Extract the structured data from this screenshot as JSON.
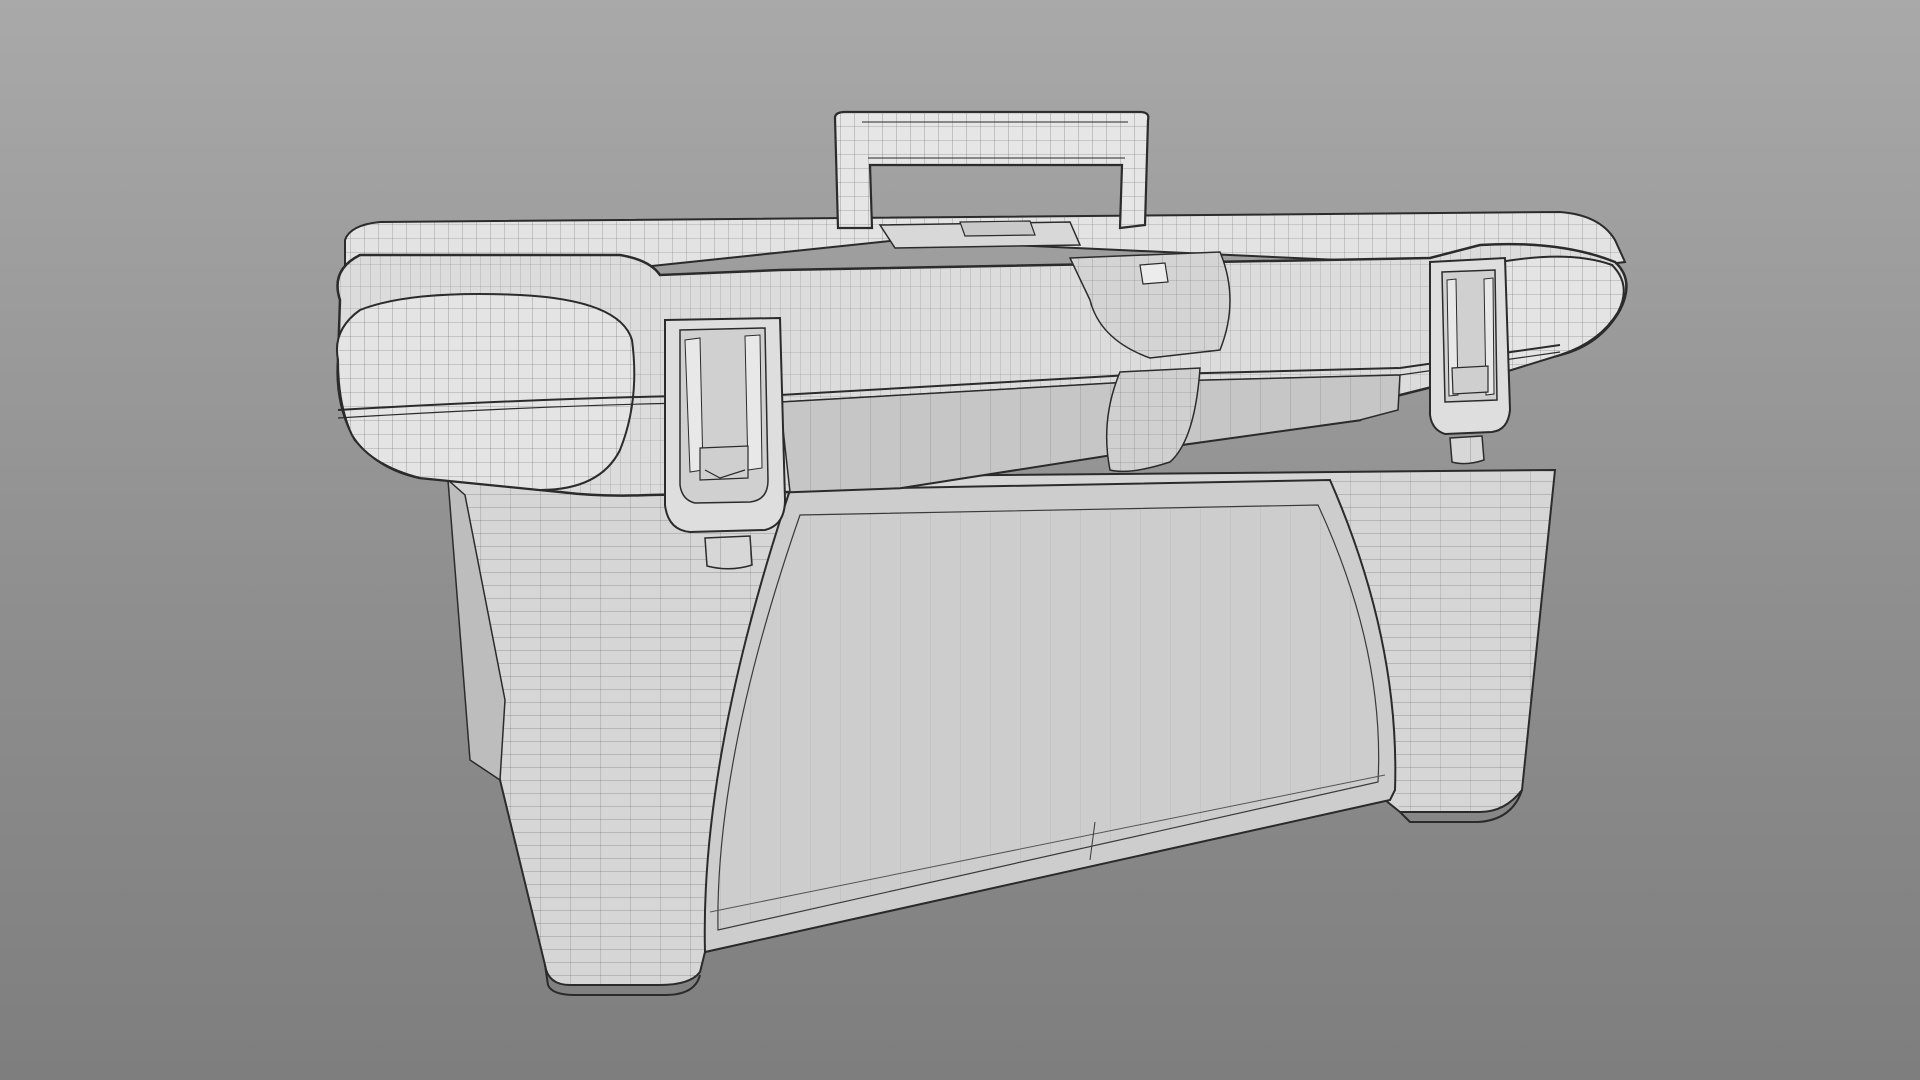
{
  "scene": {
    "subject": "toolbox-wireframe-model",
    "background_top": "#a9a9a9",
    "background_bottom": "#7e7e7e",
    "surface_fill": "#d9d9d9",
    "surface_light": "#e8e8e8",
    "panel_fill": "#cfcfcf",
    "edge_color": "#2b2b2b",
    "wire_color": "#3a3a3a"
  }
}
